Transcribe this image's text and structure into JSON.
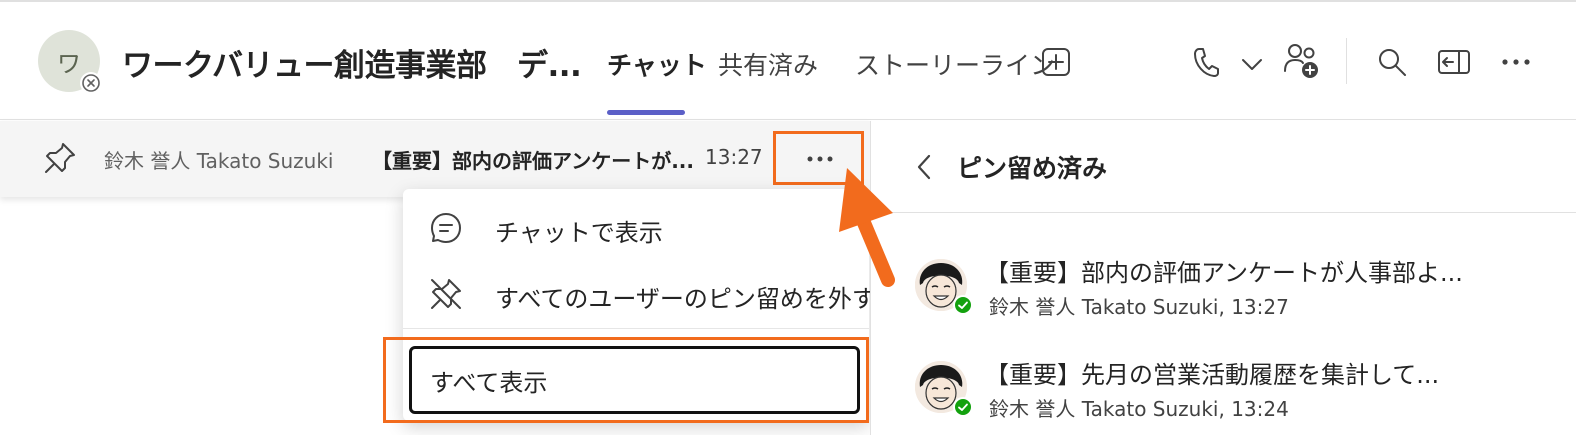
{
  "header": {
    "avatar_initial": "ワ",
    "title": "ワークバリュー創造事業部　デ...",
    "tabs": [
      {
        "label": "チャット",
        "active": true
      },
      {
        "label": "共有済み",
        "active": false
      },
      {
        "label": "ストーリーライン",
        "active": false
      }
    ],
    "icons": [
      "add-tab-icon",
      "call-icon",
      "chevron-down-icon",
      "add-people-icon",
      "search-icon",
      "open-pane-icon",
      "more-icon"
    ]
  },
  "pinned_bar": {
    "sender": "鈴木 誉人 Takato Suzuki",
    "message": "【重要】部内の評価アンケートが...",
    "time": "13:27"
  },
  "context_menu": {
    "items": [
      {
        "label": "チャットで表示",
        "icon": "chat-icon"
      },
      {
        "label": "すべてのユーザーのピン留めを外す",
        "icon": "unpin-icon"
      }
    ],
    "show_all": "すべて表示"
  },
  "right_pane": {
    "title": "ピン留め済み",
    "entries": [
      {
        "title": "【重要】部内の評価アンケートが人事部よ...",
        "meta": "鈴木 誉人 Takato Suzuki, 13:27"
      },
      {
        "title": "【重要】先月の営業活動履歴を集計して...",
        "meta": "鈴木 誉人 Takato Suzuki, 13:24"
      }
    ]
  },
  "colors": {
    "accent": "#5b5fc7",
    "highlight": "#f26b1d",
    "online": "#13a10e"
  }
}
